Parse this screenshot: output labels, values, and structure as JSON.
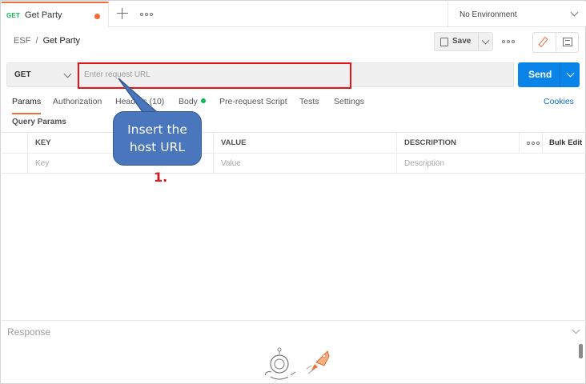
{
  "tabbar": {
    "tab_method": "GET",
    "tab_name": "Get Party",
    "environment": "No Environment",
    "icons": [
      "plus-icon",
      "more-icon",
      "chevron-down-icon"
    ]
  },
  "breadcrumb": {
    "collection": "ESF",
    "separator": "/",
    "request": "Get Party"
  },
  "toolbar": {
    "save_label": "Save"
  },
  "request": {
    "method": "GET",
    "url_placeholder": "Enter request URL",
    "url_value": "",
    "send_label": "Send"
  },
  "request_tabs": [
    "Params",
    "Authorization",
    "Headers (10)",
    "Body",
    "Pre-request Script",
    "Tests",
    "Settings"
  ],
  "active_tab": "Params",
  "cookies_label": "Cookies",
  "query_params": {
    "title": "Query Params",
    "headers": [
      "KEY",
      "VALUE",
      "DESCRIPTION"
    ],
    "bulk_edit": "Bulk Edit",
    "placeholders": {
      "key": "Key",
      "value": "Value",
      "description": "Description"
    }
  },
  "annotation": {
    "callout_line1": "Insert the",
    "callout_line2": "host URL",
    "step": "1."
  },
  "response": {
    "label": "Response"
  },
  "colors": {
    "accent_orange": "#f26b3a",
    "send_blue": "#0b84ea",
    "highlight_red": "#e3141a",
    "callout_blue": "#4a76be",
    "method_green": "#0cbb52"
  }
}
